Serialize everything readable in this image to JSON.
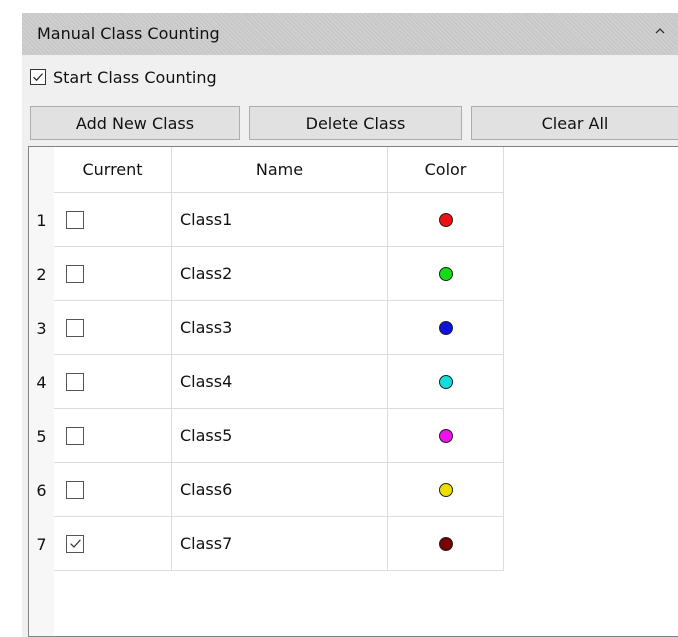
{
  "panel": {
    "title": "Manual Class Counting",
    "collapse_icon": "chevron-up-icon",
    "start_label": "Start Class Counting",
    "start_checked": true
  },
  "buttons": {
    "add_label": "Add New Class",
    "delete_label": "Delete Class",
    "clear_label": "Clear All"
  },
  "table": {
    "columns": [
      "Current",
      "Name",
      "Color"
    ],
    "rows": [
      {
        "num": "1",
        "current": false,
        "name": "Class1",
        "color": "#ee1111"
      },
      {
        "num": "2",
        "current": false,
        "name": "Class2",
        "color": "#11dd11"
      },
      {
        "num": "3",
        "current": false,
        "name": "Class3",
        "color": "#1111dd"
      },
      {
        "num": "4",
        "current": false,
        "name": "Class4",
        "color": "#11dddd"
      },
      {
        "num": "5",
        "current": false,
        "name": "Class5",
        "color": "#ee11ee"
      },
      {
        "num": "6",
        "current": false,
        "name": "Class6",
        "color": "#eedd00"
      },
      {
        "num": "7",
        "current": true,
        "name": "Class7",
        "color": "#770000"
      }
    ]
  }
}
